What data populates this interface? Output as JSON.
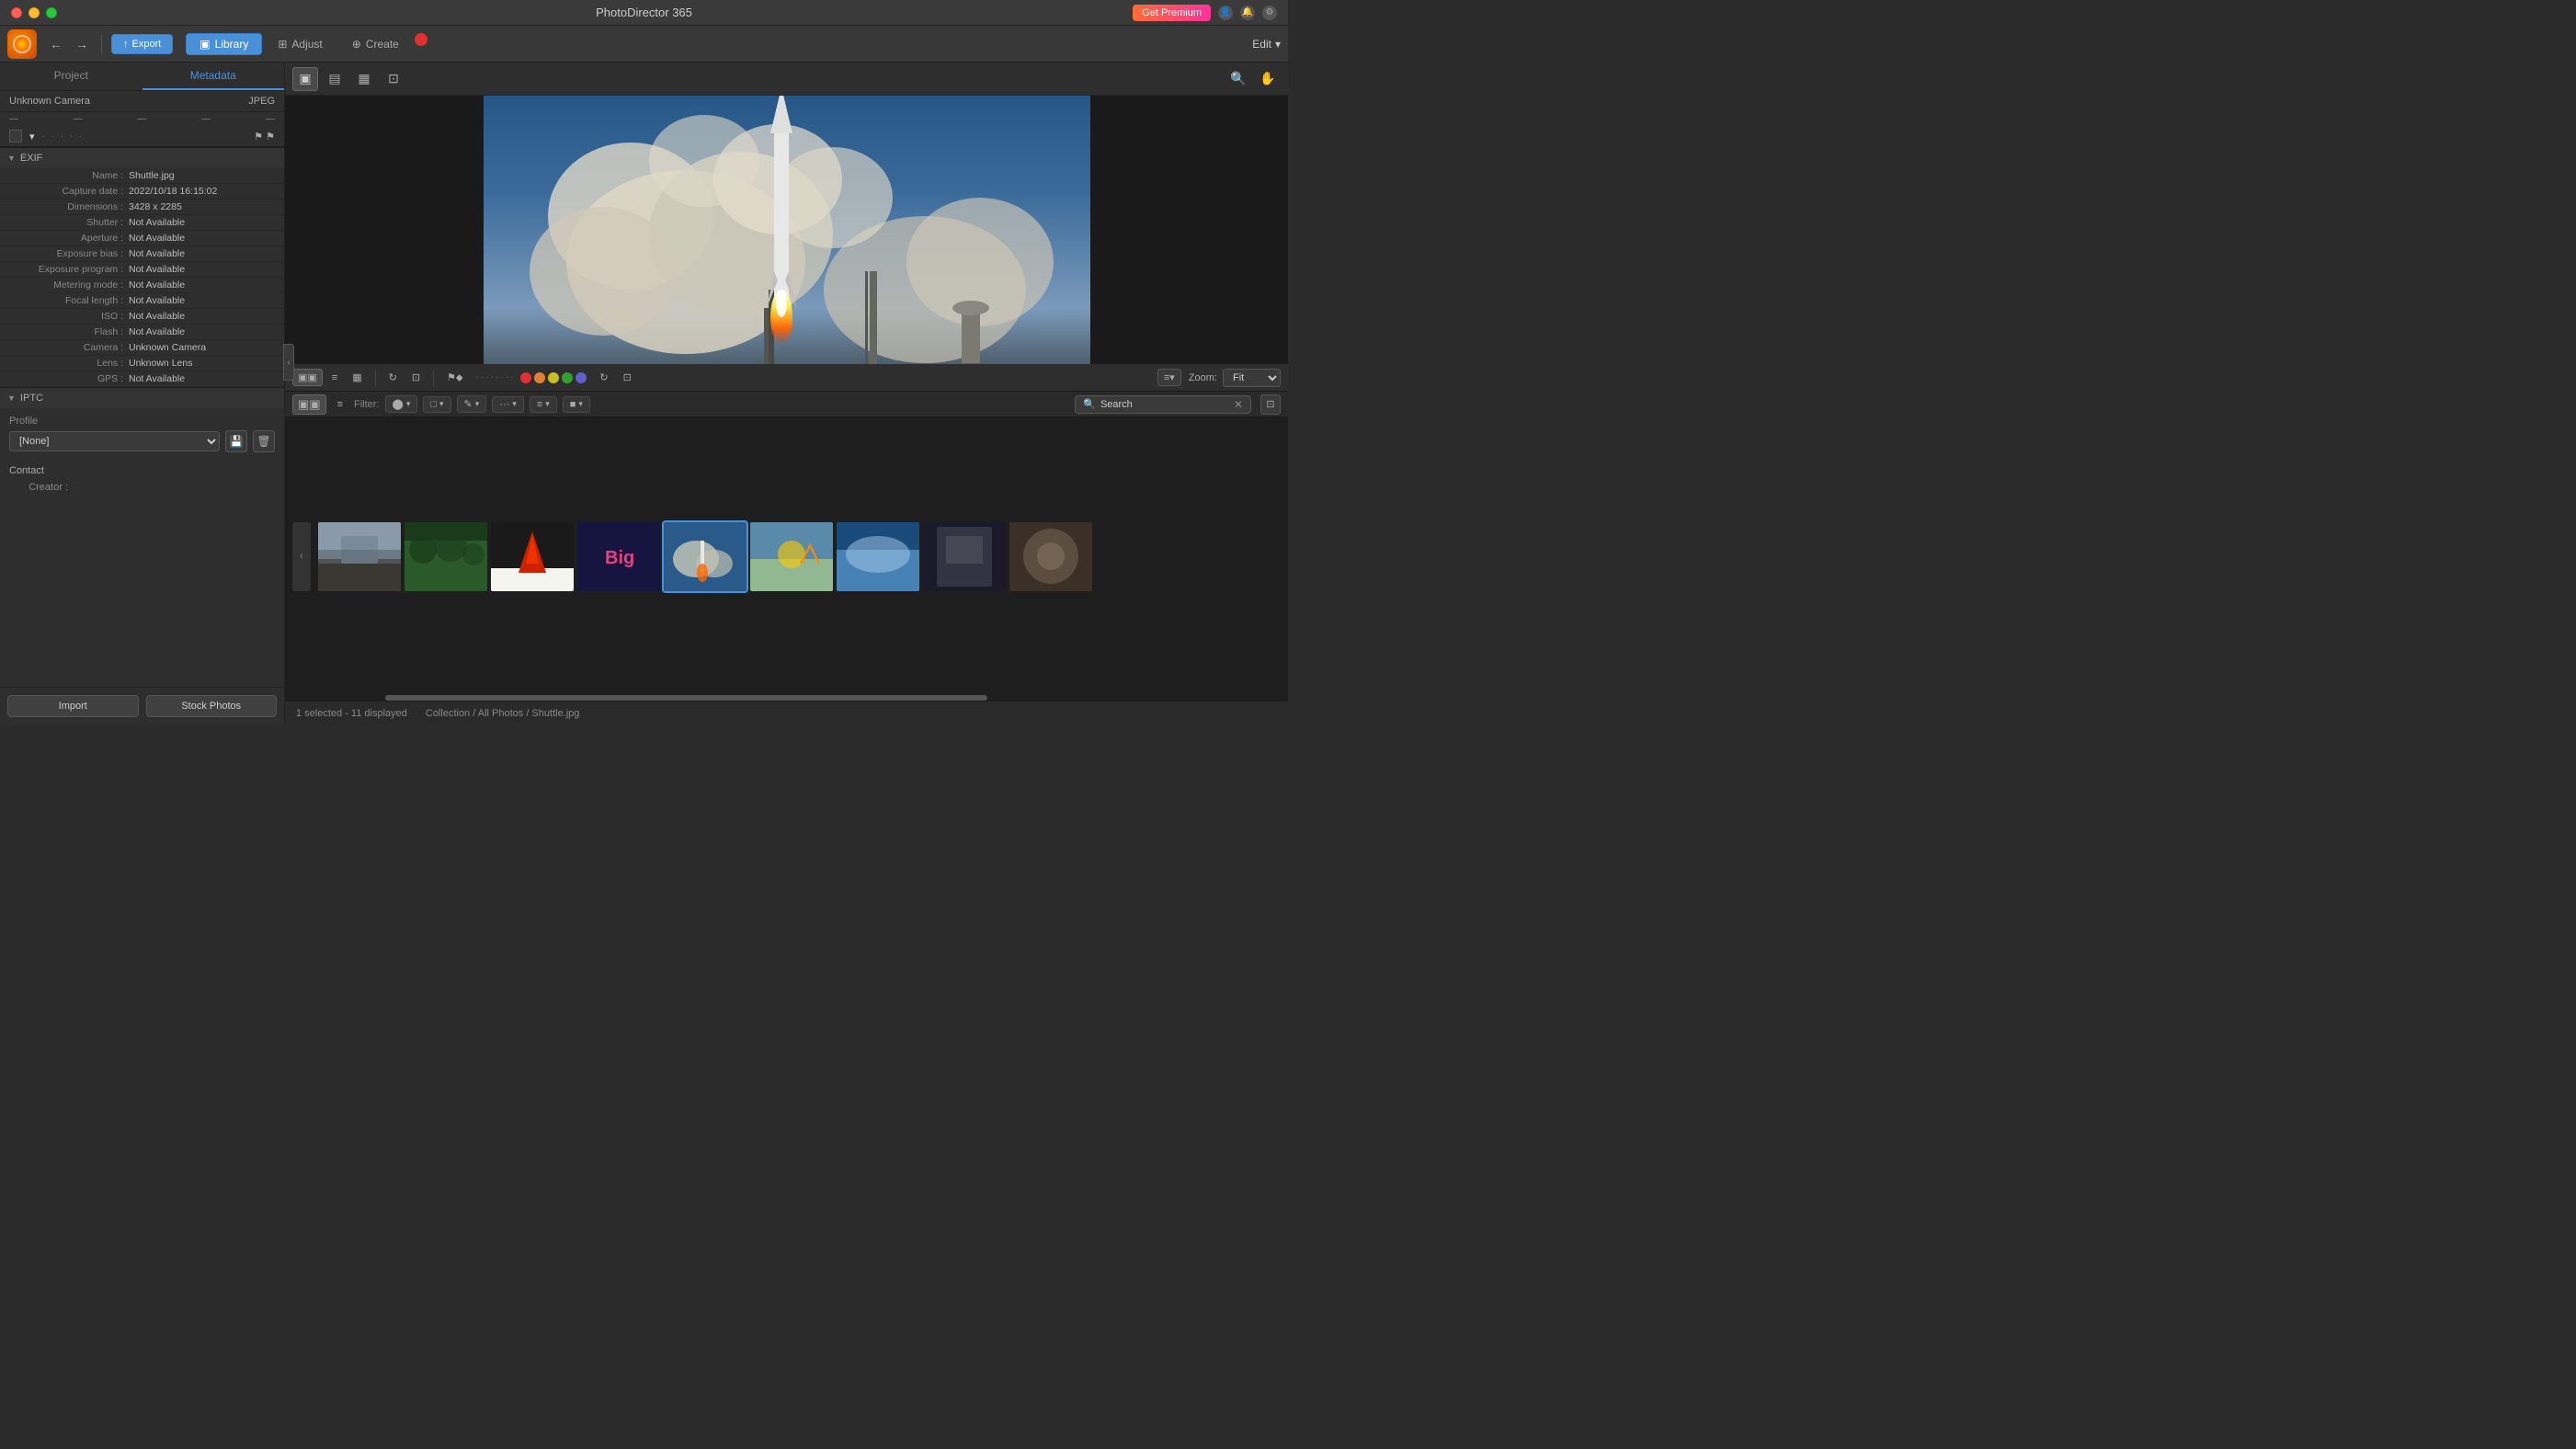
{
  "app": {
    "title": "PhotoDirector 365",
    "get_premium": "Get Premium"
  },
  "titlebar": {
    "title": "PhotoDirector 365",
    "get_premium_label": "Get Premium"
  },
  "toolbar": {
    "undo_icon": "←",
    "redo_icon": "→",
    "export_label": "Export",
    "library_label": "Library",
    "adjust_label": "Adjust",
    "create_label": "Create",
    "edit_label": "Edit"
  },
  "left_panel": {
    "tab_project": "Project",
    "tab_metadata": "Metadata",
    "camera": "Unknown Camera",
    "format": "JPEG",
    "exif_section": "EXIF",
    "iptc_section": "IPTC",
    "exif_fields": [
      {
        "label": "Name :",
        "value": "Shuttle.jpg"
      },
      {
        "label": "Capture date :",
        "value": "2022/10/18 16:15:02"
      },
      {
        "label": "Dimensions :",
        "value": "3428 x 2285"
      },
      {
        "label": "Shutter :",
        "value": "Not Available"
      },
      {
        "label": "Aperture :",
        "value": "Not Available"
      },
      {
        "label": "Exposure bias :",
        "value": "Not Available"
      },
      {
        "label": "Exposure program :",
        "value": "Not Available"
      },
      {
        "label": "Metering mode :",
        "value": "Not Available"
      },
      {
        "label": "Focal length :",
        "value": "Not Available"
      },
      {
        "label": "ISO :",
        "value": "Not Available"
      },
      {
        "label": "Flash :",
        "value": "Not Available"
      },
      {
        "label": "Camera :",
        "value": "Unknown Camera"
      },
      {
        "label": "Lens :",
        "value": "Unknown Lens"
      },
      {
        "label": "GPS :",
        "value": "Not Available"
      }
    ],
    "iptc_profile_label": "Profile",
    "iptc_profile_value": "[None]",
    "iptc_contact_label": "Contact",
    "iptc_creator_label": "Creator :",
    "iptc_creator_value": "",
    "import_btn": "Import",
    "stock_photos_btn": "Stock Photos"
  },
  "view_toolbar": {
    "view_icons": [
      "▣",
      "▤",
      "▦",
      "⊡"
    ],
    "search_icon": "🔍",
    "hand_icon": "✋"
  },
  "strip_toolbar": {
    "view1": "▣",
    "view2": "≡",
    "view3": "▦",
    "filter_label": "Filter:",
    "colors": [
      "#e03030",
      "#e08030",
      "#c8c020",
      "#30a030",
      "#6060cc"
    ],
    "rotate_icon": "↻",
    "crop_icon": "⊡",
    "sort_icon": "≡",
    "zoom_label": "Zoom:",
    "zoom_value": "Fit"
  },
  "filter_bar": {
    "filter_label": "Filter:",
    "filter_all": "⬤▽",
    "filter_shape": "□▽",
    "filter_edit": "✎▽",
    "filter_more": "···▽",
    "filter_lines": "≡▽",
    "filter_color": "■▽",
    "search_placeholder": "Search",
    "search_value": "Search"
  },
  "thumbnails": [
    {
      "id": 1,
      "cls": "thumb-1",
      "selected": false
    },
    {
      "id": 2,
      "cls": "thumb-2",
      "selected": false
    },
    {
      "id": 3,
      "cls": "thumb-3",
      "selected": false
    },
    {
      "id": 4,
      "cls": "thumb-4",
      "selected": false
    },
    {
      "id": 5,
      "cls": "thumb-5",
      "selected": true
    },
    {
      "id": 6,
      "cls": "thumb-6",
      "selected": false
    },
    {
      "id": 7,
      "cls": "thumb-7",
      "selected": false
    },
    {
      "id": 8,
      "cls": "thumb-8",
      "selected": false
    },
    {
      "id": 9,
      "cls": "thumb-9",
      "selected": false
    }
  ],
  "status": {
    "selection_text": "1 selected - 11 displayed",
    "path_text": "Collection / All Photos / Shuttle.jpg"
  }
}
